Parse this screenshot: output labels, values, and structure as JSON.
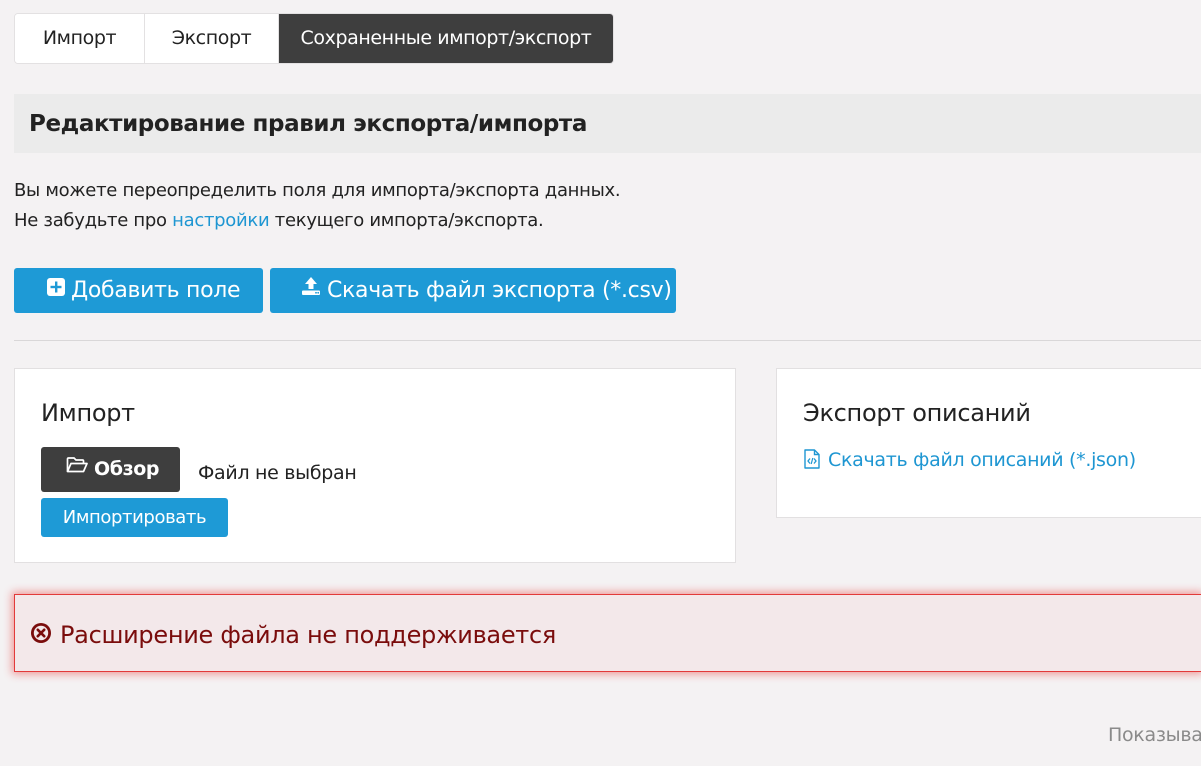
{
  "tabs": [
    {
      "label": "Импорт",
      "active": false
    },
    {
      "label": "Экспорт",
      "active": false
    },
    {
      "label": "Сохраненные импорт/экспорт",
      "active": true
    }
  ],
  "section": {
    "title": "Редактирование правил экспорта/импорта"
  },
  "description": {
    "line1": "Вы можете переопределить поля для импорта/экспорта данных.",
    "line2_before": "Не забудьте про ",
    "line2_link": "настройки",
    "line2_after": " текущего импорта/экспорта."
  },
  "actions": {
    "add_field": {
      "label": "Добавить поле",
      "icon": "plus-square-icon"
    },
    "download_export": {
      "label": "Скачать файл экспорта (*.csv)",
      "icon": "upload-icon"
    }
  },
  "import_panel": {
    "title": "Импорт",
    "browse_label": "Обзор",
    "browse_icon": "folder-open-icon",
    "file_status": "Файл не выбран",
    "import_button": "Импортировать"
  },
  "export_panel": {
    "title": "Экспорт описаний",
    "link_label": "Скачать файл описаний (*.json)",
    "link_icon": "file-code-icon"
  },
  "error": {
    "message": "Расширение файла не поддерживается",
    "icon": "times-circle-icon"
  },
  "footer": {
    "text": "Показыва"
  },
  "colors": {
    "accent_blue": "#1e9ad6",
    "dark_button": "#3e3e3e",
    "error_text": "#7a0c0c",
    "error_border": "#e23a3a"
  }
}
